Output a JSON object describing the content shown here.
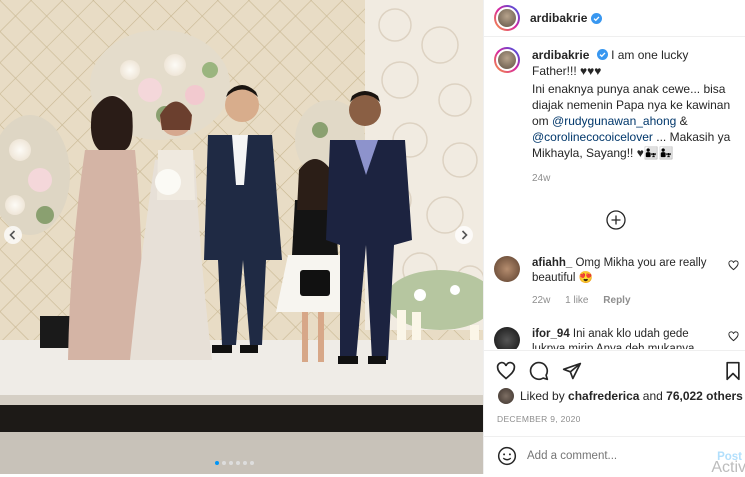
{
  "post": {
    "username": "ardibakrie",
    "caption_text": "I am one lucky Father!!! ♥♥♥",
    "caption_line2": "Ini enaknya punya anak cewe... bisa diajak nemenin Papa nya ke kawinan om",
    "mention1": "@rudygunawan_ahong",
    "amp": "&",
    "mention2": "@corolinecocoicelover",
    "caption_line3": "... Makasih ya Mikhayla, Sayang!! ♥👨‍👧👨‍👧",
    "age": "24w",
    "liked_by_prefix": "Liked by",
    "liked_by_user": "chafrederica",
    "liked_by_suffix": "and",
    "likes_count": "76,022 others",
    "date": "DECEMBER 9, 2020",
    "add_comment_placeholder": "Add a comment...",
    "post_label": "Post",
    "activate_label": "Activ"
  },
  "comments": [
    {
      "user": "afiahh_",
      "text": "Omg Mikha you are really beautiful 😍",
      "age": "22w",
      "likes": "1 like",
      "reply": "Reply"
    },
    {
      "user": "ifor_94",
      "text": "Ini anak klo udah gede lukpva mirip Anya deh mukanya"
    }
  ],
  "colors": {
    "accent": "#0095f6",
    "verified": "#3897f0",
    "muted": "#8e8e8e"
  }
}
